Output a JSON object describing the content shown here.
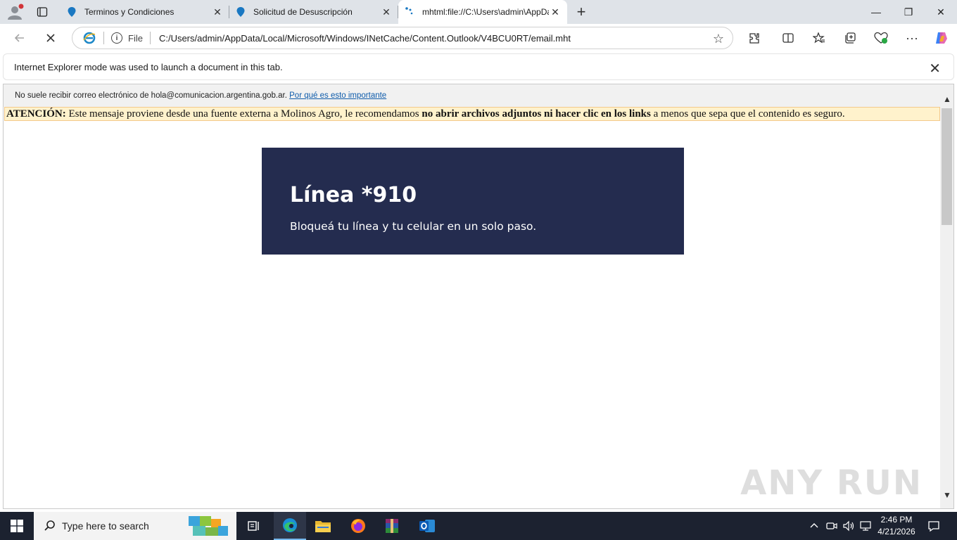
{
  "tabs": [
    {
      "title": "Terminos y Condiciones",
      "icon": "map-pin-icon"
    },
    {
      "title": "Solicitud de Desuscripción",
      "icon": "map-pin-icon"
    },
    {
      "title": "mhtml:file://C:\\Users\\admin\\AppData",
      "icon": "loading-icon",
      "active": true
    }
  ],
  "window_controls": {
    "minimize": "—",
    "restore": "❐",
    "close": "✕"
  },
  "address": {
    "scheme_label": "File",
    "url": "C:/Users/admin/AppData/Local/Microsoft/Windows/INetCache/Content.Outlook/V4BCU0RT/email.mht"
  },
  "infobar": {
    "message": "Internet Explorer mode was used to launch a document in this tab."
  },
  "email": {
    "outlook_note": "No suele recibir correo electrónico de hola@comunicacion.argentina.gob.ar.",
    "outlook_link": "Por qué es esto importante",
    "warn_label": "ATENCIÓN:",
    "warn_text_1": " Este mensaje proviene desde una fuente externa a Molinos Agro, le recomendamos ",
    "warn_bold": "no abrir archivos adjuntos ni hacer clic en los links",
    "warn_text_2": " a menos que sepa que el contenido es seguro.",
    "banner_title": "Línea *910",
    "banner_subtitle": "Bloqueá tu línea y tu celular en un solo paso.",
    "banner_color": "#242c4f"
  },
  "watermark": "ANY RUN",
  "taskbar": {
    "search_placeholder": "Type here to search",
    "apps": [
      "task-view-icon",
      "edge-icon",
      "file-explorer-icon",
      "firefox-icon",
      "winrar-icon",
      "outlook-icon"
    ],
    "time": "2:46 PM",
    "date": "4/21/2026"
  }
}
